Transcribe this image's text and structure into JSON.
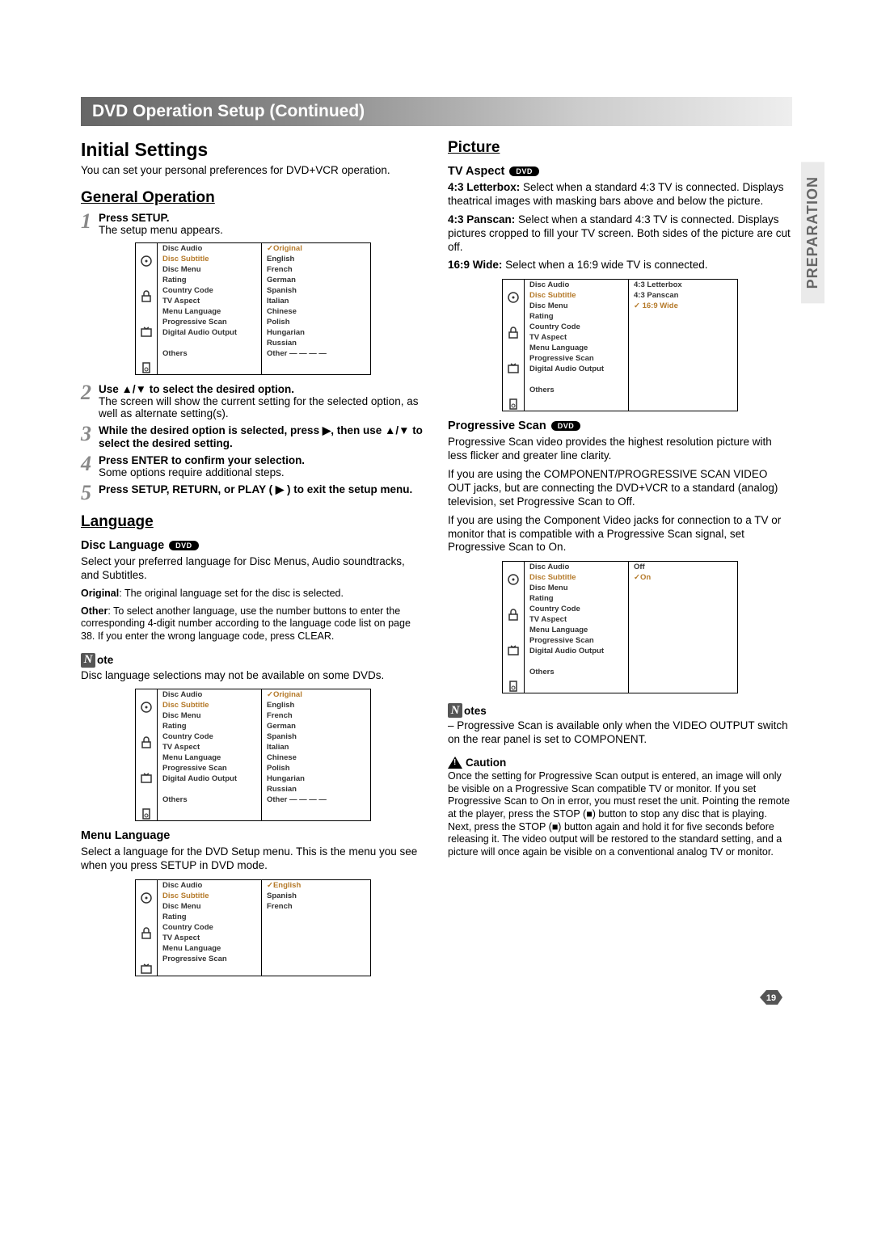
{
  "title_bar": "DVD Operation Setup (Continued)",
  "spine_label": "PREPARATION",
  "page_number": "19",
  "dvd_badge": "DVD",
  "note_letter": "N",
  "left": {
    "initial_settings": "Initial Settings",
    "initial_intro": "You can set your personal preferences for DVD+VCR operation.",
    "general_operation": "General Operation",
    "steps": {
      "1": {
        "lead": "Press SETUP.",
        "body": "The setup menu appears."
      },
      "2": {
        "lead": "Use ▲/▼ to select the desired option.",
        "body": "The screen will show the current setting for the selected option, as well as alternate setting(s)."
      },
      "3": {
        "lead": "While the desired option is selected, press ▶, then use ▲/▼ to select the desired setting.",
        "body": ""
      },
      "4": {
        "lead": "Press ENTER to confirm your selection.",
        "body": "Some options require additional steps."
      },
      "5": {
        "lead": "Press SETUP, RETURN, or PLAY ( ▶ ) to exit the setup menu.",
        "body": ""
      }
    },
    "language": "Language",
    "disc_language": "Disc Language",
    "disc_lang_body": "Select your preferred language for Disc Menus, Audio soundtracks, and Subtitles.",
    "original_line_lead": "Original",
    "original_line_body": ": The original language set for the disc is selected.",
    "other_line_lead": "Other",
    "other_line_body": ": To select another language, use the number buttons to enter the corresponding 4-digit number according to the language code list on page 38. If you enter the wrong language code, press CLEAR.",
    "note_label": "ote",
    "note_body": "Disc language selections may not be available on some DVDs.",
    "menu_language": "Menu Language",
    "menu_language_body": "Select a language for the DVD Setup menu. This is the menu you see when you press SETUP in DVD mode."
  },
  "right": {
    "picture": "Picture",
    "tv_aspect": "TV Aspect",
    "letterbox_lead": "4:3 Letterbox:",
    "letterbox_body": " Select when a standard 4:3 TV is connected. Displays theatrical images with masking bars above and below the picture.",
    "panscan_lead": "4:3 Panscan:",
    "panscan_body": " Select when a standard 4:3 TV is connected. Displays pictures cropped to fill your TV screen. Both sides of the picture are cut off.",
    "wide_lead": "16:9 Wide:",
    "wide_body": " Select when a 16:9 wide TV is connected.",
    "progressive_scan": "Progressive Scan",
    "ps_body1": "Progressive Scan video provides the highest resolution picture with less flicker and greater line clarity.",
    "ps_body2": "If you are using the COMPONENT/PROGRESSIVE SCAN VIDEO OUT jacks, but are connecting the DVD+VCR to a standard (analog) television, set Progressive Scan to Off.",
    "ps_body3": "If you are using the Component Video jacks for connection to a TV or monitor that is compatible with a Progressive Scan signal, set Progressive Scan to On.",
    "notes_label": "otes",
    "notes_body": "– Progressive Scan is available only when the VIDEO OUTPUT switch on the rear panel is set to COMPONENT.",
    "caution_label": "Caution",
    "caution_body": "Once the setting for Progressive Scan output is entered, an image will only be visible on a Progressive Scan compatible TV or monitor. If you set Progressive Scan to On in error, you must reset the unit. Pointing the remote at the player, press the STOP (■) button to stop any disc that is playing. Next, press the STOP (■) button again and hold it for five seconds before releasing it. The video output will be restored to the standard setting, and a picture will once again be visible on a conventional analog TV or monitor."
  },
  "menus": {
    "left_items": [
      "Disc Audio",
      "Disc Subtitle",
      "Disc Menu",
      "Rating",
      "Country Code",
      "TV Aspect",
      "Menu Language",
      "Progressive Scan",
      "Digital Audio Output",
      "",
      "Others"
    ],
    "lang_options": [
      "✓Original",
      "English",
      "French",
      "German",
      "Spanish",
      "Italian",
      "Chinese",
      "Polish",
      "Hungarian",
      "Russian",
      "Other  — — — —"
    ],
    "aspect_options": [
      "4:3 Letterbox",
      "4:3 Panscan",
      "✓ 16:9 Wide"
    ],
    "ps_options": [
      "Off",
      "✓On"
    ],
    "menulang_options": [
      "✓English",
      "Spanish",
      "French"
    ]
  }
}
